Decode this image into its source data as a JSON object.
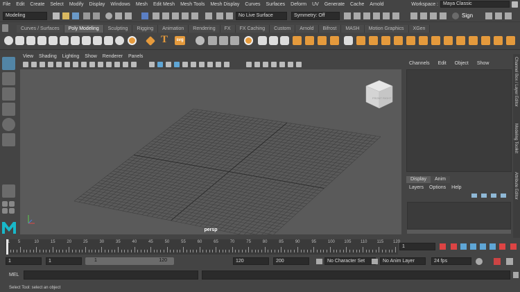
{
  "menubar": {
    "items": [
      "File",
      "Edit",
      "Create",
      "Select",
      "Modify",
      "Display",
      "Windows",
      "Mesh",
      "Edit Mesh",
      "Mesh Tools",
      "Mesh Display",
      "Curves",
      "Surfaces",
      "Deform",
      "UV",
      "Generate",
      "Cache",
      "Arnold"
    ],
    "workspace_label": "Workspace :",
    "workspace_value": "Maya Classic"
  },
  "statusline": {
    "menuset": "Modeling",
    "live_surface": "No Live Surface",
    "symmetry": "Symmetry: Off",
    "signin": "Sign"
  },
  "shelf": {
    "tabs": [
      "Curves / Surfaces",
      "Poly Modeling",
      "Sculpting",
      "Rigging",
      "Animation",
      "Rendering",
      "FX",
      "FX Caching",
      "Custom",
      "Arnold",
      "Bifrost",
      "MASH",
      "Motion Graphics",
      "XGen"
    ],
    "active_tab": "Poly Modeling",
    "text_tool_glyph": "T",
    "svg_tool_label": "svg"
  },
  "viewport": {
    "menus": [
      "View",
      "Shading",
      "Lighting",
      "Show",
      "Renderer",
      "Panels"
    ],
    "camera_label": "persp",
    "viewcube_front": "FRONT",
    "viewcube_right": "RIGHT"
  },
  "channelbox": {
    "menus": [
      "Channels",
      "Edit",
      "Object",
      "Show"
    ]
  },
  "layereditor": {
    "tabs": [
      "Display",
      "Anim"
    ],
    "active_tab": "Display",
    "menus": [
      "Layers",
      "Options",
      "Help"
    ]
  },
  "sidetabs": [
    "Channel Box / Layer Editor",
    "Modeling Toolkit",
    "Attribute Editor"
  ],
  "timeslider": {
    "ticks": [
      "5",
      "10",
      "15",
      "20",
      "25",
      "30",
      "35",
      "40",
      "45",
      "50",
      "55",
      "60",
      "65",
      "70",
      "75",
      "80",
      "85",
      "90",
      "95",
      "100",
      "105",
      "110",
      "115",
      "120"
    ],
    "current_frame": "1",
    "frame_start_label": "1"
  },
  "rangebar": {
    "start": "1",
    "playback_start": "1",
    "range_start": "1",
    "range_end": "120",
    "playback_end": "120",
    "end": "200",
    "character_set": "No Character Set",
    "anim_layer": "No Anim Layer",
    "fps": "24 fps"
  },
  "cmdline": {
    "label": "MEL"
  },
  "helpline": {
    "text": "Select Tool: select an object"
  },
  "colors": {
    "accent": "#e59a3c",
    "panel": "#444444",
    "viewport_bg": "#5a5a5a",
    "playhead": "#e8e8e8"
  }
}
